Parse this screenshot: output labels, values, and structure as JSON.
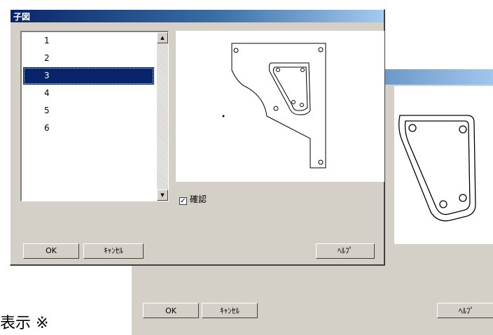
{
  "dialog": {
    "title": "子図",
    "list_items": [
      "1",
      "2",
      "3",
      "4",
      "5",
      "6"
    ],
    "selected_index": 2,
    "checkbox": {
      "label": "確認",
      "checked": true,
      "mark": "✓"
    },
    "buttons": {
      "ok": "OK",
      "cancel": "ｷｬﾝｾﾙ",
      "help": "ﾍﾙﾌﾟ"
    }
  },
  "background_window": {
    "buttons": {
      "ok": "OK",
      "cancel": "ｷｬﾝｾﾙ",
      "help": "ﾍﾙﾌﾟ"
    }
  },
  "bottom_text": "表示 ※",
  "colors": {
    "titlebar": "#0a246a",
    "dialog_bg": "#d4d0c8",
    "selection": "#0a246a"
  }
}
